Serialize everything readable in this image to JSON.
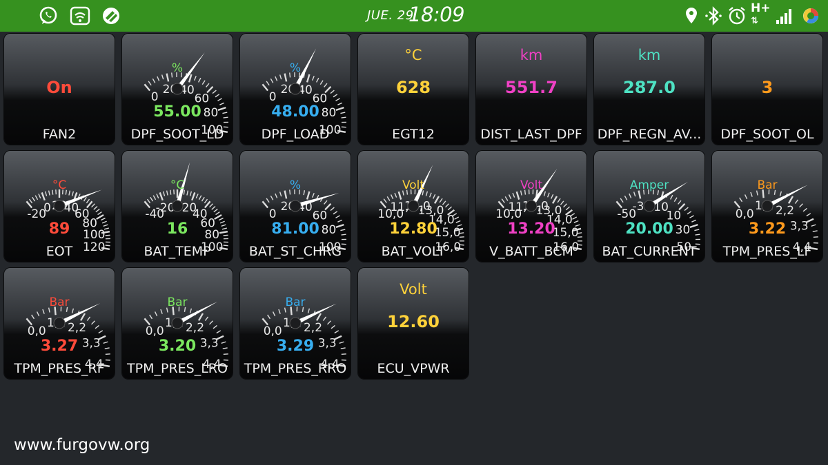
{
  "status_bar": {
    "date": "JUE. 29",
    "time": "18:09",
    "network": "H+",
    "left_icons": [
      "whatsapp-icon",
      "wifi-sync-icon",
      "app-logo-icon"
    ],
    "right_icons": [
      "location-icon",
      "bluetooth-icon",
      "alarm-icon",
      "network-type-icon",
      "signal-icon",
      "browser-icon"
    ]
  },
  "tiles": [
    {
      "kind": "digital",
      "name": "FAN2",
      "unit": "",
      "value": "On",
      "color": "#ff4b3a"
    },
    {
      "kind": "gauge",
      "name": "DPF_SOOT_LD",
      "unit": "%",
      "value": "55.00",
      "reading": 55,
      "min": 0,
      "max": 100,
      "ticks": [
        "0",
        "20",
        "40",
        "60",
        "80",
        "100"
      ],
      "color": "#7be75f"
    },
    {
      "kind": "gauge",
      "name": "DPF_LOAD",
      "unit": "%",
      "value": "48.00",
      "reading": 48,
      "min": 0,
      "max": 100,
      "ticks": [
        "0",
        "20",
        "40",
        "60",
        "80",
        "100"
      ],
      "color": "#37aef0"
    },
    {
      "kind": "digital",
      "name": "EGT12",
      "unit": "°C",
      "value": "628",
      "color": "#ffd23a"
    },
    {
      "kind": "digital",
      "name": "DIST_LAST_DPF",
      "unit": "km",
      "value": "551.7",
      "color": "#f041c5"
    },
    {
      "kind": "digital",
      "name": "DPF_REGN_AV...",
      "unit": "km",
      "value": "287.0",
      "color": "#4ee2c3"
    },
    {
      "kind": "digital",
      "name": "DPF_SOOT_OL",
      "unit": "",
      "value": "3",
      "color": "#ff9a1c"
    },
    {
      "kind": "gauge",
      "name": "EOT",
      "unit": "°C",
      "value": "89",
      "reading": 89,
      "min": -20,
      "max": 120,
      "ticks": [
        "-20",
        "0",
        "20",
        "40",
        "60",
        "80",
        "100",
        "120"
      ],
      "color": "#ff4b3a"
    },
    {
      "kind": "gauge",
      "name": "BAT_TEMP",
      "unit": "°C",
      "value": "16",
      "reading": 16,
      "min": -40,
      "max": 100,
      "ticks": [
        "-40",
        "-20",
        "0",
        "20",
        "40",
        "60",
        "80",
        "100"
      ],
      "color": "#7be75f"
    },
    {
      "kind": "gauge",
      "name": "BAT_ST_CHRG",
      "unit": "%",
      "value": "81.00",
      "reading": 81,
      "min": 0,
      "max": 100,
      "ticks": [
        "0",
        "20",
        "40",
        "60",
        "80",
        "100"
      ],
      "color": "#37aef0"
    },
    {
      "kind": "gauge",
      "name": "BAT_VOLT",
      "unit": "Volt",
      "value": "12.80",
      "reading": 12.8,
      "min": 10,
      "max": 16,
      "ticks": [
        "10,0",
        "11,0",
        "12,0",
        "13,0",
        "14,0",
        "15,0",
        "16,0"
      ],
      "color": "#ffd23a"
    },
    {
      "kind": "gauge",
      "name": "V_BATT_BCM",
      "unit": "Volt",
      "value": "13.20",
      "reading": 13.2,
      "min": 10,
      "max": 16,
      "ticks": [
        "10,0",
        "11,0",
        "12,0",
        "13,0",
        "14,0",
        "15,0",
        "16,0"
      ],
      "color": "#f041c5"
    },
    {
      "kind": "gauge",
      "name": "BAT_CURRENT",
      "unit": "Amper",
      "value": "20.00",
      "reading": 20,
      "min": -50,
      "max": 50,
      "ticks": [
        "-50",
        "-30",
        "-10",
        "10",
        "30",
        "50"
      ],
      "color": "#4ee2c3"
    },
    {
      "kind": "gauge",
      "name": "TPM_PRES_LF",
      "unit": "Bar",
      "value": "3.22",
      "reading": 3.22,
      "min": 0,
      "max": 4.4,
      "ticks": [
        "0,0",
        "1,1",
        "2,2",
        "3,3",
        "4,4"
      ],
      "color": "#ff9a1c"
    },
    {
      "kind": "gauge",
      "name": "TPM_PRES_RF",
      "unit": "Bar",
      "value": "3.27",
      "reading": 3.27,
      "min": 0,
      "max": 4.4,
      "ticks": [
        "0,0",
        "1,1",
        "2,2",
        "3,3",
        "4,4"
      ],
      "color": "#ff4b3a"
    },
    {
      "kind": "gauge",
      "name": "TPM_PRES_LRO",
      "unit": "Bar",
      "value": "3.20",
      "reading": 3.2,
      "min": 0,
      "max": 4.4,
      "ticks": [
        "0,0",
        "1,1",
        "2,2",
        "3,3",
        "4,4"
      ],
      "color": "#7be75f"
    },
    {
      "kind": "gauge",
      "name": "TPM_PRES_RRO",
      "unit": "Bar",
      "value": "3.29",
      "reading": 3.29,
      "min": 0,
      "max": 4.4,
      "ticks": [
        "0,0",
        "1,1",
        "2,2",
        "3,3",
        "4,4"
      ],
      "color": "#37aef0"
    },
    {
      "kind": "digital",
      "name": "ECU_VPWR",
      "unit": "Volt",
      "value": "12.60",
      "color": "#ffd23a"
    }
  ],
  "watermark": "www.furgovw.org"
}
